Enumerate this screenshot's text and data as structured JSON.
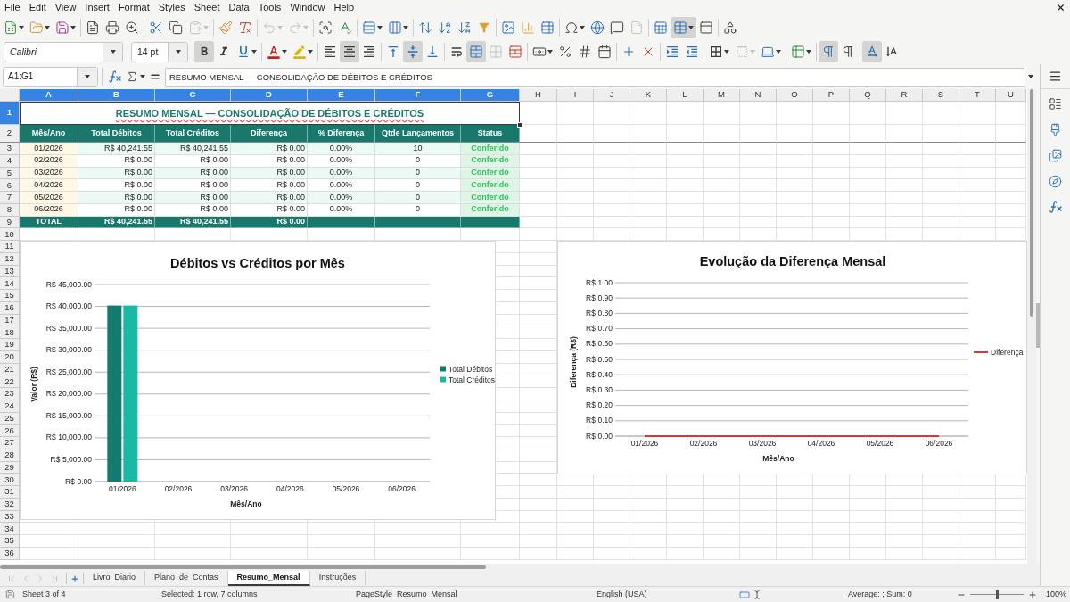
{
  "menu_bar": {
    "items": [
      "File",
      "Edit",
      "View",
      "Insert",
      "Format",
      "Styles",
      "Sheet",
      "Data",
      "Tools",
      "Window",
      "Help"
    ]
  },
  "standard_toolbar": [
    [
      {
        "active": false,
        "disabled": false
      },
      {
        "active": false,
        "disabled": false
      },
      {
        "active": false,
        "disabled": false
      }
    ],
    [
      {
        "active": false,
        "disabled": false
      },
      {
        "active": false,
        "disabled": false
      },
      {
        "active": false,
        "disabled": false
      }
    ],
    [
      {
        "active": false,
        "disabled": false
      },
      {
        "active": false,
        "disabled": false
      },
      {
        "active": false,
        "disabled": true
      }
    ],
    [
      {
        "active": false,
        "disabled": false
      },
      {
        "active": false,
        "disabled": false
      }
    ],
    [
      {
        "active": false,
        "disabled": true
      },
      {
        "active": false,
        "disabled": true
      }
    ],
    [
      {
        "active": false,
        "disabled": false
      },
      {
        "active": false,
        "disabled": false
      }
    ],
    [
      {
        "active": false,
        "disabled": false
      },
      {
        "active": false,
        "disabled": false
      }
    ],
    [
      {
        "active": false,
        "disabled": false
      },
      {
        "active": false,
        "disabled": false
      },
      {
        "active": false,
        "disabled": false
      },
      {
        "active": false,
        "disabled": false
      }
    ],
    [
      {
        "active": false,
        "disabled": false
      },
      {
        "active": false,
        "disabled": false
      },
      {
        "active": false,
        "disabled": false
      }
    ],
    [
      {
        "active": false,
        "disabled": false
      },
      {
        "active": false,
        "disabled": false
      },
      {
        "active": false,
        "disabled": false
      },
      {
        "active": false,
        "disabled": true
      }
    ],
    [
      {
        "active": false,
        "disabled": false
      },
      {
        "active": true,
        "disabled": false
      },
      {
        "active": false,
        "disabled": false
      }
    ],
    [
      {
        "active": false,
        "disabled": false
      }
    ]
  ],
  "formatting_toolbar": {
    "font_name": {
      "value": "Calibri"
    },
    "font_size": {
      "value": "14 pt"
    },
    "groups": [
      [
        {
          "active": true,
          "disabled": false
        },
        {
          "active": false,
          "disabled": false
        },
        {
          "active": false,
          "disabled": false
        }
      ],
      [
        {
          "active": false,
          "disabled": false
        },
        {
          "active": false,
          "disabled": false
        }
      ],
      [
        {
          "active": false,
          "disabled": false
        },
        {
          "active": true,
          "disabled": false
        },
        {
          "active": false,
          "disabled": false
        }
      ],
      [
        {
          "active": false,
          "disabled": false
        },
        {
          "active": true,
          "disabled": false
        },
        {
          "active": false,
          "disabled": false
        }
      ],
      [
        {
          "active": false,
          "disabled": false
        },
        {
          "active": true,
          "disabled": false
        },
        {
          "active": false,
          "disabled": true
        },
        {
          "active": false,
          "disabled": false
        }
      ],
      [
        {
          "active": false,
          "disabled": false
        },
        {
          "active": false,
          "disabled": false
        },
        {
          "active": false,
          "disabled": false
        },
        {
          "active": false,
          "disabled": false
        }
      ],
      [
        {
          "active": false,
          "disabled": false
        },
        {
          "active": false,
          "disabled": false
        }
      ],
      [
        {
          "active": false,
          "disabled": false
        },
        {
          "active": false,
          "disabled": false
        }
      ],
      [
        {
          "active": false,
          "disabled": false
        },
        {
          "active": false,
          "disabled": true
        },
        {
          "active": false,
          "disabled": false
        }
      ],
      [
        {
          "active": false,
          "disabled": false
        }
      ],
      [
        {
          "active": true,
          "disabled": false
        },
        {
          "active": false,
          "disabled": false
        }
      ],
      [
        {
          "active": true,
          "disabled": false
        },
        {
          "active": false,
          "disabled": false
        }
      ]
    ]
  },
  "formula_bar": {
    "name_box": "A1:G1",
    "content": "RESUMO MENSAL — CONSOLIDAÇÃO DE DÉBITOS E CRÉDITOS"
  },
  "sheet": {
    "columns": [
      {
        "label": "A",
        "selected": true
      },
      {
        "label": "B",
        "selected": true
      },
      {
        "label": "C",
        "selected": true
      },
      {
        "label": "D",
        "selected": true
      },
      {
        "label": "E",
        "selected": true
      },
      {
        "label": "F",
        "selected": true
      },
      {
        "label": "G",
        "selected": true
      },
      {
        "label": "H",
        "selected": false
      },
      {
        "label": "I",
        "selected": false
      },
      {
        "label": "J",
        "selected": false
      },
      {
        "label": "K",
        "selected": false
      },
      {
        "label": "L",
        "selected": false
      },
      {
        "label": "M",
        "selected": false
      },
      {
        "label": "N",
        "selected": false
      },
      {
        "label": "O",
        "selected": false
      },
      {
        "label": "P",
        "selected": false
      },
      {
        "label": "Q",
        "selected": false
      },
      {
        "label": "R",
        "selected": false
      },
      {
        "label": "S",
        "selected": false
      },
      {
        "label": "T",
        "selected": false
      },
      {
        "label": "U",
        "selected": false
      }
    ],
    "rows": [
      {
        "label": "1",
        "selected": true
      },
      {
        "label": "2",
        "selected": false
      },
      {
        "label": "3",
        "selected": false
      },
      {
        "label": "4",
        "selected": false
      },
      {
        "label": "5",
        "selected": false
      },
      {
        "label": "6",
        "selected": false
      },
      {
        "label": "7",
        "selected": false
      },
      {
        "label": "8",
        "selected": false
      },
      {
        "label": "9",
        "selected": false
      },
      {
        "label": "10",
        "selected": false
      },
      {
        "label": "11",
        "selected": false
      },
      {
        "label": "12",
        "selected": false
      },
      {
        "label": "13",
        "selected": false
      },
      {
        "label": "14",
        "selected": false
      },
      {
        "label": "15",
        "selected": false
      },
      {
        "label": "16",
        "selected": false
      },
      {
        "label": "17",
        "selected": false
      },
      {
        "label": "18",
        "selected": false
      },
      {
        "label": "19",
        "selected": false
      },
      {
        "label": "20",
        "selected": false
      },
      {
        "label": "21",
        "selected": false
      },
      {
        "label": "22",
        "selected": false
      },
      {
        "label": "23",
        "selected": false
      },
      {
        "label": "24",
        "selected": false
      },
      {
        "label": "25",
        "selected": false
      },
      {
        "label": "26",
        "selected": false
      },
      {
        "label": "27",
        "selected": false
      },
      {
        "label": "28",
        "selected": false
      },
      {
        "label": "29",
        "selected": false
      },
      {
        "label": "30",
        "selected": false
      },
      {
        "label": "31",
        "selected": false
      },
      {
        "label": "32",
        "selected": false
      },
      {
        "label": "33",
        "selected": false
      },
      {
        "label": "34",
        "selected": false
      },
      {
        "label": "35",
        "selected": false
      },
      {
        "label": "36",
        "selected": false
      }
    ],
    "table": {
      "title": "RESUMO MENSAL — CONSOLIDAÇÃO DE DÉBITOS E CRÉDITOS",
      "header": [
        "Mês/Ano",
        "Total Débitos",
        "Total Créditos",
        "Diferença",
        "% Diferença",
        "Qtde Lançamentos",
        "Status"
      ],
      "rows": [
        [
          "01/2026",
          "R$ 40,241.55",
          "R$ 40,241.55",
          "R$ 0.00",
          "0.00%",
          "10",
          "Conferido"
        ],
        [
          "02/2026",
          "R$ 0.00",
          "R$ 0.00",
          "R$ 0.00",
          "0.00%",
          "0",
          "Conferido"
        ],
        [
          "03/2026",
          "R$ 0.00",
          "R$ 0.00",
          "R$ 0.00",
          "0.00%",
          "0",
          "Conferido"
        ],
        [
          "04/2026",
          "R$ 0.00",
          "R$ 0.00",
          "R$ 0.00",
          "0.00%",
          "0",
          "Conferido"
        ],
        [
          "05/2026",
          "R$ 0.00",
          "R$ 0.00",
          "R$ 0.00",
          "0.00%",
          "0",
          "Conferido"
        ],
        [
          "06/2026",
          "R$ 0.00",
          "R$ 0.00",
          "R$ 0.00",
          "0.00%",
          "0",
          "Conferido"
        ]
      ],
      "total": [
        "TOTAL",
        "R$ 40,241.55",
        "R$ 40,241.55",
        "R$ 0.00"
      ]
    }
  },
  "charts": [
    {
      "y_tick_units": [
        "R$",
        "R$",
        "R$",
        "R$",
        "R$",
        "R$",
        "R$",
        "R$",
        "R$",
        "R$"
      ],
      "chart_data": {
        "type": "bar",
        "title": "Débitos vs Créditos por Mês",
        "xlabel": "Mês/Ano",
        "ylabel": "Valor (R$)",
        "categories": [
          "01/2026",
          "02/2026",
          "03/2026",
          "04/2026",
          "05/2026",
          "06/2026"
        ],
        "series": [
          {
            "name": "Total Débitos",
            "color": "#137a6e",
            "values": [
              40200,
              0,
              0,
              0,
              0,
              0
            ]
          },
          {
            "name": "Total Créditos",
            "color": "#1ab9a5",
            "values": [
              40200,
              0,
              0,
              0,
              0,
              0
            ]
          }
        ],
        "ylim": [
          0,
          45000
        ],
        "yticks": [
          {
            "value": 0,
            "label": "0.00"
          },
          {
            "value": 5000,
            "label": "5,000.00"
          },
          {
            "value": 10000,
            "label": "10,000.00"
          },
          {
            "value": 15000,
            "label": "15,000.00"
          },
          {
            "value": 20000,
            "label": "20,000.00"
          },
          {
            "value": 25000,
            "label": "25,000.00"
          },
          {
            "value": 30000,
            "label": "30,000.00"
          },
          {
            "value": 35000,
            "label": "35,000.00"
          },
          {
            "value": 40000,
            "label": "40,000.00"
          },
          {
            "value": 45000,
            "label": "45,000.00"
          }
        ],
        "grid": true,
        "legend": "right"
      }
    },
    {
      "y_tick_units": [
        "R$",
        "R$",
        "R$",
        "R$",
        "R$",
        "R$",
        "R$",
        "R$",
        "R$",
        "R$",
        "R$"
      ],
      "chart_data": {
        "type": "line",
        "title": "Evolução da Diferença Mensal",
        "xlabel": "Mês/Ano",
        "ylabel": "Diferença (R$)",
        "categories": [
          "01/2026",
          "02/2026",
          "03/2026",
          "04/2026",
          "05/2026",
          "06/2026"
        ],
        "series": [
          {
            "name": "Diferença",
            "color": "#d63a35",
            "values": [
              0,
              0,
              0,
              0,
              0,
              0
            ]
          }
        ],
        "ylim": [
          0,
          1
        ],
        "yticks": [
          {
            "value": 0,
            "label": "0.00"
          },
          {
            "value": 0.1,
            "label": "0.10"
          },
          {
            "value": 0.2,
            "label": "0.20"
          },
          {
            "value": 0.3,
            "label": "0.30"
          },
          {
            "value": 0.4,
            "label": "0.40"
          },
          {
            "value": 0.5,
            "label": "0.50"
          },
          {
            "value": 0.6,
            "label": "0.60"
          },
          {
            "value": 0.7,
            "label": "0.70"
          },
          {
            "value": 0.8,
            "label": "0.80"
          },
          {
            "value": 0.9,
            "label": "0.90"
          },
          {
            "value": 1,
            "label": "1.00"
          }
        ],
        "grid": true,
        "legend": "right"
      }
    }
  ],
  "sheet_tabs": {
    "navigation": [
      {
        "disabled": true
      },
      {
        "disabled": true
      },
      {
        "disabled": true
      },
      {
        "disabled": true
      }
    ],
    "tabs": [
      {
        "label": "Livro_Diario",
        "selected": false
      },
      {
        "label": "Plano_de_Contas",
        "selected": false
      },
      {
        "label": "Resumo_Mensal",
        "selected": true
      },
      {
        "label": "Instruções",
        "selected": false
      }
    ]
  },
  "status_bar": {
    "sheet": "Sheet 3 of 4",
    "selection": "Selected: 1 row, 7 columns",
    "page_style": "PageStyle_Resumo_Mensal",
    "language": "English (USA)",
    "statistics": "Average: ; Sum: 0",
    "zoom": {
      "level": 0.5,
      "value": "100%"
    }
  }
}
